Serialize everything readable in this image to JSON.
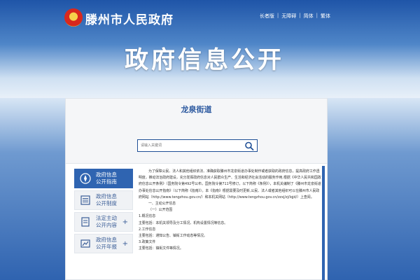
{
  "header": {
    "site_title": "滕州市人民政府",
    "top_links": [
      "长者版",
      "无障碍",
      "简体",
      "繁体"
    ],
    "main_title": "政府信息公开"
  },
  "panel": {
    "title": "龙泉街道",
    "search": {
      "placeholder": "请输入关键词"
    }
  },
  "sidebar": {
    "items": [
      {
        "label_line1": "政府信息",
        "label_line2": "公开指南",
        "icon": "guide-icon",
        "active": true,
        "expandable": false
      },
      {
        "label_line1": "政府信息",
        "label_line2": "公开制度",
        "icon": "document-list-icon",
        "active": false,
        "expandable": false
      },
      {
        "label_line1": "法定主动",
        "label_line2": "公开内容",
        "icon": "folder-icon",
        "active": false,
        "expandable": true
      },
      {
        "label_line1": "政府信息",
        "label_line2": "公开年报",
        "icon": "report-icon",
        "active": false,
        "expandable": true
      }
    ],
    "plus_symbol": "+"
  },
  "content": {
    "paragraphs": [
      "为了保障公民、法人和其他组织依法、准确获取滕州市龙泉街道办事处制作或者获取的政府信息，提高政府工作透明度，推动法治政府建设，充分发挥政府信息对人民群众生产、生活和经济社会活动的服务作用,根据《中华人民共和国政府信息公开条例》（国务院令第492号公布，国务院令第711号修订，以下简称《条例》），本机关编制了《滕州市龙泉街道办事处信息公开指南》（以下简称《指南》）。本《指南》根据需要及时更新,公民、法人或者其他组织可以在滕州市人民政府网站（http://www.tengzhou.gov.cn/）和本机关网站（http://www.tengzhou.gov.cn/zzxj/zj/lqjd/）上查阅。",
      "一、主动公开信息",
      "（一）公开范围",
      "1.概况信息",
      "主要包括：本机关领导及分工情况、机构设置情况等信息。",
      "2.工作信息",
      "主要包括：通知公告、镇街工作动态等情况。",
      "3.政策文件",
      "主要包括：镇街文件等情况。"
    ]
  },
  "colors": {
    "accent": "#2f64b1",
    "title_blue": "#2d5aa0"
  }
}
